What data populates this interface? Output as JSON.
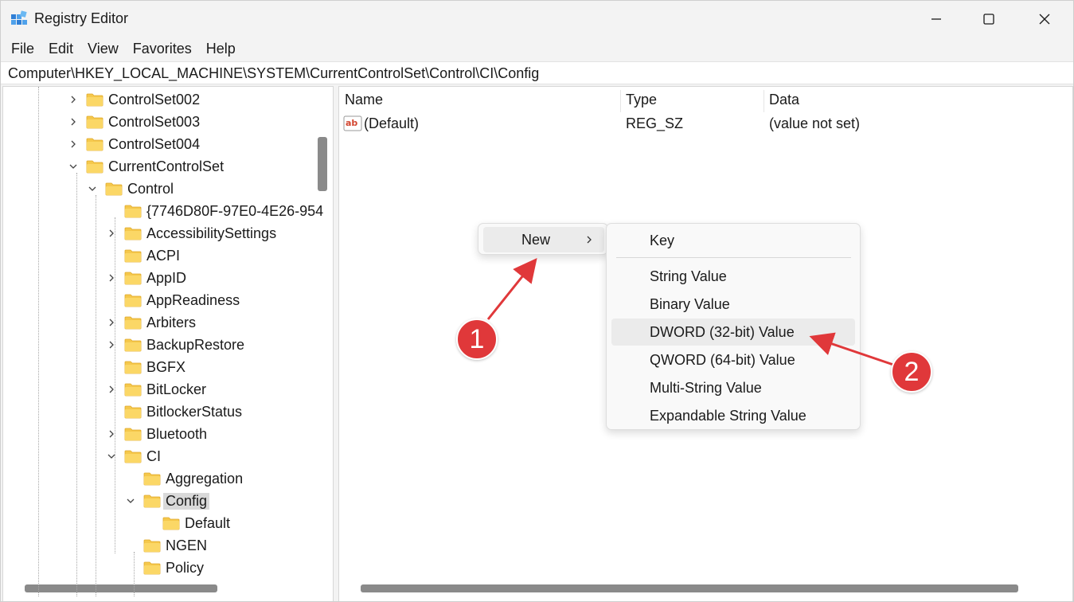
{
  "window": {
    "title": "Registry Editor"
  },
  "menubar": {
    "items": [
      "File",
      "Edit",
      "View",
      "Favorites",
      "Help"
    ]
  },
  "address": {
    "path": "Computer\\HKEY_LOCAL_MACHINE\\SYSTEM\\CurrentControlSet\\Control\\CI\\Config"
  },
  "tree": {
    "items": [
      {
        "label": "ControlSet002",
        "expander": "collapsed"
      },
      {
        "label": "ControlSet003",
        "expander": "collapsed"
      },
      {
        "label": "ControlSet004",
        "expander": "collapsed"
      },
      {
        "label": "CurrentControlSet",
        "expander": "expanded"
      },
      {
        "label": "Control",
        "expander": "expanded"
      },
      {
        "label": "{7746D80F-97E0-4E26-954",
        "expander": "none"
      },
      {
        "label": "AccessibilitySettings",
        "expander": "collapsed"
      },
      {
        "label": "ACPI",
        "expander": "none"
      },
      {
        "label": "AppID",
        "expander": "collapsed"
      },
      {
        "label": "AppReadiness",
        "expander": "none"
      },
      {
        "label": "Arbiters",
        "expander": "collapsed"
      },
      {
        "label": "BackupRestore",
        "expander": "collapsed"
      },
      {
        "label": "BGFX",
        "expander": "none"
      },
      {
        "label": "BitLocker",
        "expander": "collapsed"
      },
      {
        "label": "BitlockerStatus",
        "expander": "none"
      },
      {
        "label": "Bluetooth",
        "expander": "collapsed"
      },
      {
        "label": "CI",
        "expander": "expanded"
      },
      {
        "label": "Aggregation",
        "expander": "none"
      },
      {
        "label": "Config",
        "expander": "expanded",
        "selected": true
      },
      {
        "label": "Default",
        "expander": "none"
      },
      {
        "label": "NGEN",
        "expander": "none"
      },
      {
        "label": "Policy",
        "expander": "none"
      }
    ]
  },
  "list": {
    "columns": [
      "Name",
      "Type",
      "Data"
    ],
    "rows": [
      {
        "name": "(Default)",
        "type": "REG_SZ",
        "data": "(value not set)",
        "icon": "string-value-icon"
      }
    ]
  },
  "context_menu": {
    "primary": {
      "label": "New"
    },
    "submenu": {
      "items": [
        "Key",
        "String Value",
        "Binary Value",
        "DWORD (32-bit) Value",
        "QWORD (64-bit) Value",
        "Multi-String Value",
        "Expandable String Value"
      ],
      "highlighted": "DWORD (32-bit) Value"
    }
  },
  "annotations": {
    "badge1": "1",
    "badge2": "2",
    "color": "#e0383a"
  },
  "colors": {
    "folder": "#f5c84c",
    "selection": "#d9d9d9",
    "accent_red": "#e0383a"
  }
}
